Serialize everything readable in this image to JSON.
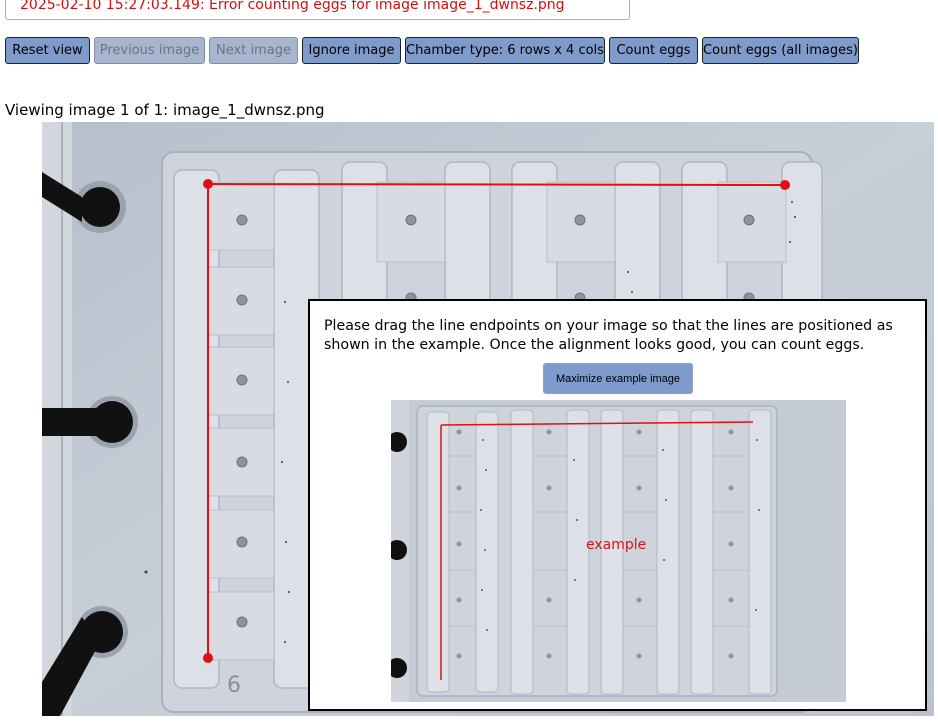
{
  "log": {
    "message": "2025-02-10 15:27:03.149: Error counting eggs for image image_1_dwnsz.png",
    "color": "#d01010"
  },
  "toolbar": {
    "reset_view": "Reset view",
    "previous_image": "Previous image",
    "next_image": "Next image",
    "ignore_image": "Ignore image",
    "chamber_type": "Chamber type: 6 rows x 4 cols",
    "count_eggs": "Count eggs",
    "count_eggs_all": "Count eggs (all images)"
  },
  "viewer": {
    "status": "Viewing image 1 of 1: image_1_dwnsz.png"
  },
  "overlay": {
    "instructions": "Please drag the line endpoints on your image so that the lines are positioned as shown in the example. Once the alignment looks good, you can count eggs.",
    "maximize_label": "Maximize example image",
    "example_label": "example"
  },
  "colors": {
    "button": "#7e9bcb",
    "button_disabled": "#a7b6ce",
    "alignment_line": "#e01010",
    "error_text": "#d01010"
  },
  "icons": {
    "image_viewer": "chamber-photo",
    "example": "example-chamber-photo"
  }
}
